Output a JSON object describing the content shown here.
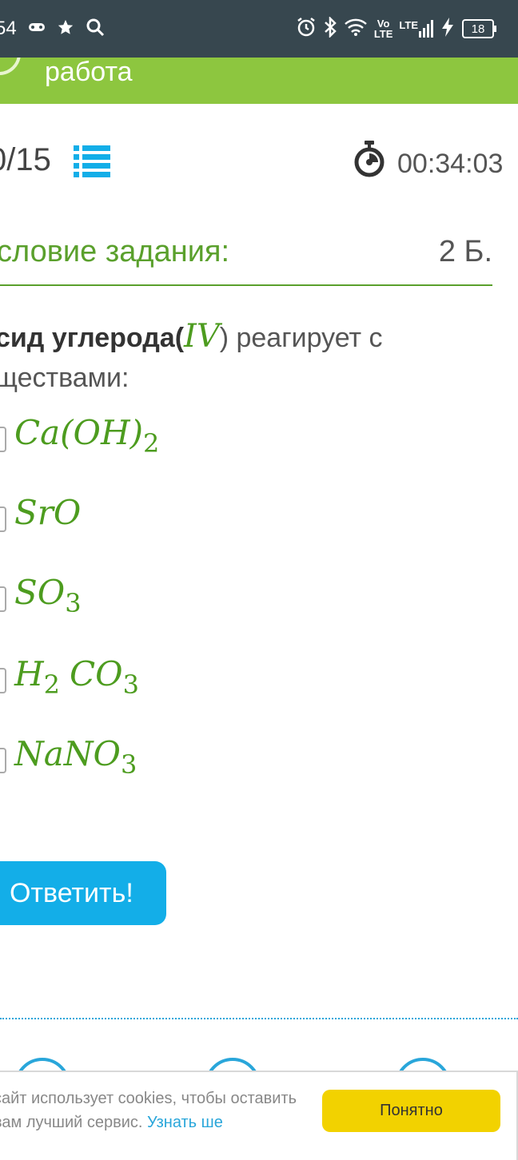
{
  "status_bar": {
    "time_partial": "54",
    "volte_top": "Vo",
    "volte_bottom": "LTE",
    "lte_label": "LTE",
    "battery": "18",
    "icons": [
      "gamepad-icon",
      "star-icon",
      "search-icon",
      "alarm-icon",
      "bluetooth-icon",
      "wifi-icon",
      "signal-icon",
      "charging-icon"
    ]
  },
  "header": {
    "title": "работа"
  },
  "progress": {
    "count": "0/15",
    "timer": "00:34:03"
  },
  "condition": {
    "label": "словие задания:",
    "points": "2 Б."
  },
  "question": {
    "text_bold": "сид углерода(",
    "math": "IV",
    "text_after": ") реагирует с",
    "line2": "ществами:"
  },
  "options": [
    {
      "parts": [
        "Ca(OH)",
        "2"
      ]
    },
    {
      "parts": [
        "SrO"
      ]
    },
    {
      "parts": [
        "SO",
        "3"
      ]
    },
    {
      "parts": [
        "H",
        "2",
        "CO",
        "3"
      ]
    },
    {
      "parts": [
        "NaNO",
        "3"
      ]
    }
  ],
  "answer_button": "Ответить!",
  "cookie": {
    "text": "сайт использует cookies, чтобы оставить вам лучший сервис.",
    "link": "Узнать ше",
    "button": "Понятно"
  },
  "colors": {
    "status_bar": "#37474f",
    "header_green": "#8dc63f",
    "accent_green": "#5aa02c",
    "accent_blue": "#13aee8",
    "cookie_button": "#f2d200"
  }
}
